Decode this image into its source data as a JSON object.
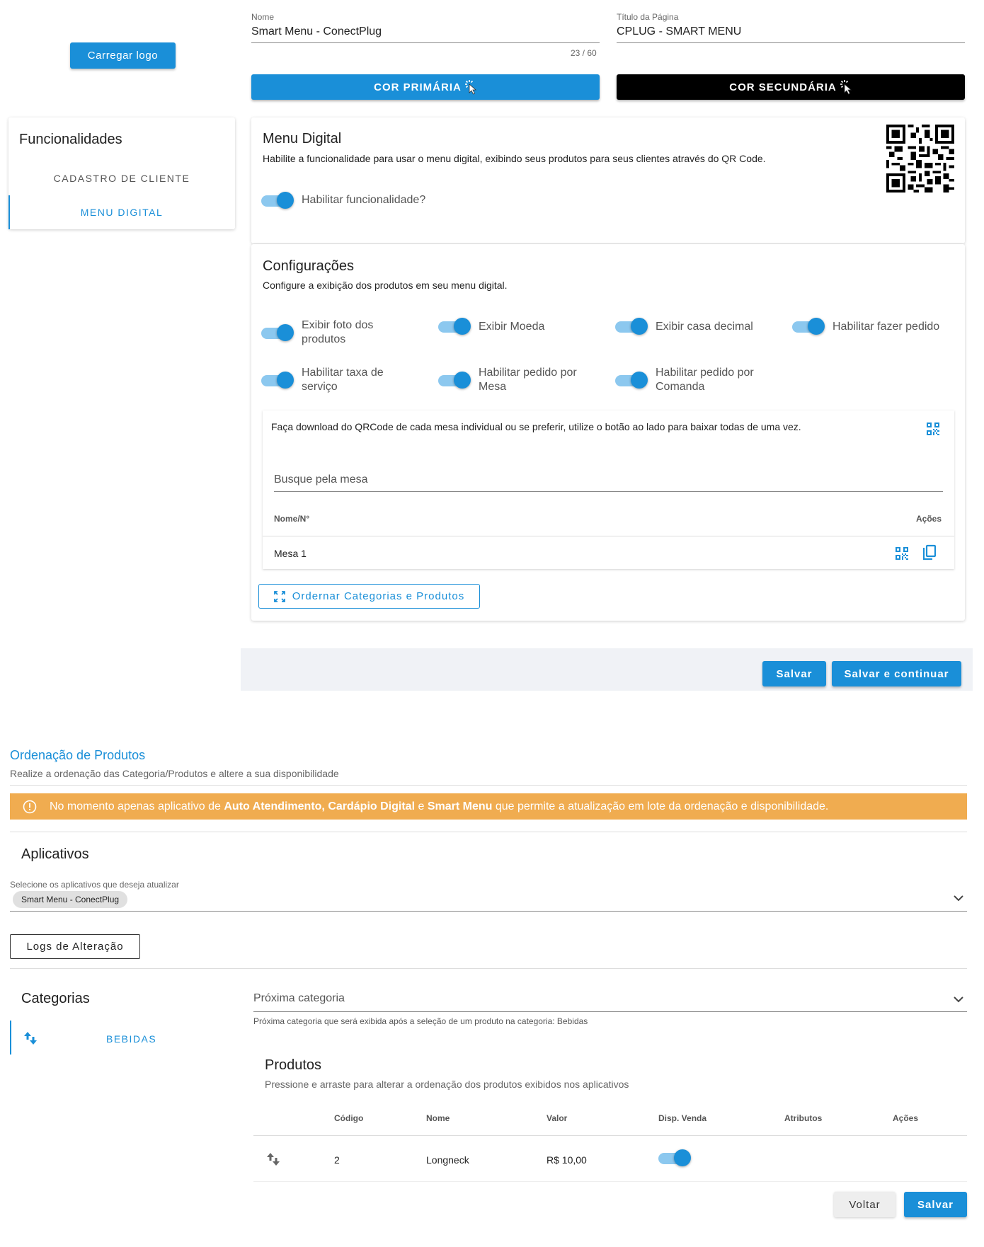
{
  "header": {
    "logo_button": "Carregar logo",
    "name_label": "Nome",
    "name_value": "Smart Menu - ConectPlug",
    "name_counter": "23 / 60",
    "title_label": "Título da Página",
    "title_value": "CPLUG - SMART MENU",
    "primary_color_button": "COR PRIMÁRIA",
    "secondary_color_button": "COR SECUNDÁRIA",
    "primary_color": "#1a8fd8",
    "secondary_color": "#000000"
  },
  "features": {
    "title": "Funcionalidades",
    "items": [
      {
        "label": "CADASTRO DE CLIENTE",
        "active": false
      },
      {
        "label": "MENU DIGITAL",
        "active": true
      }
    ]
  },
  "menu_digital": {
    "title": "Menu Digital",
    "description": "Habilite a funcionalidade para usar o menu digital, exibindo seus produtos para seus clientes através do QR Code.",
    "enable_label": "Habilitar funcionalidade?",
    "enabled": true
  },
  "config": {
    "title": "Configurações",
    "description": "Configure a exibição dos produtos em seu menu digital.",
    "toggles": [
      {
        "label": "Exibir foto dos produtos",
        "on": true
      },
      {
        "label": "Exibir Moeda",
        "on": true
      },
      {
        "label": "Exibir casa decimal",
        "on": true
      },
      {
        "label": "Habilitar fazer pedido",
        "on": true
      },
      {
        "label": "Habilitar taxa de serviço",
        "on": true
      },
      {
        "label": "Habilitar pedido por Mesa",
        "on": true
      },
      {
        "label": "Habilitar pedido por Comanda",
        "on": true
      }
    ]
  },
  "tables": {
    "info": "Faça download do QRCode de cada mesa individual ou se preferir, utilize o botão ao lado para baixar todas de uma vez.",
    "search_placeholder": "Busque pela mesa",
    "col_name": "Nome/N°",
    "col_actions": "Ações",
    "rows": [
      {
        "name": "Mesa 1"
      }
    ]
  },
  "order_button": "Ordernar Categorias e Produtos",
  "footer": {
    "save": "Salvar",
    "save_continue": "Salvar e continuar"
  },
  "ordering": {
    "title": "Ordenação de Produtos",
    "description": "Realize a ordenação das Categoria/Produtos e altere a sua disponibilidade",
    "alert_prefix": "No momento apenas aplicativo de ",
    "alert_app1": "Auto Atendimento,",
    "alert_app2": "Cardápio Digital",
    "alert_mid": " e ",
    "alert_app3": "Smart Menu",
    "alert_suffix": " que permite a atualização em lote da ordenação e disponibilidade.",
    "alert_color": "#f0ac50",
    "apps_title": "Aplicativos",
    "apps_select_label": "Selecione os aplicativos que deseja atualizar",
    "apps_selected": "Smart Menu - ConectPlug",
    "logs_button": "Logs de Alteração",
    "categories_title": "Categorias",
    "categories": [
      {
        "label": "BEBIDAS"
      }
    ],
    "next_category_label": "Próxima categoria",
    "next_category_hint": "Próxima categoria que será exibida após a seleção de um produto na categoria: Bebidas",
    "products_title": "Produtos",
    "products_desc": "Pressione e arraste para alterar a ordenação dos produtos exibidos nos aplicativos",
    "columns": [
      "Código",
      "Nome",
      "Valor",
      "Disp. Venda",
      "Atributos",
      "Ações"
    ],
    "products": [
      {
        "code": "2",
        "name": "Longneck",
        "price": "R$ 10,00",
        "available": true
      }
    ],
    "back_button": "Voltar",
    "save_button": "Salvar"
  }
}
